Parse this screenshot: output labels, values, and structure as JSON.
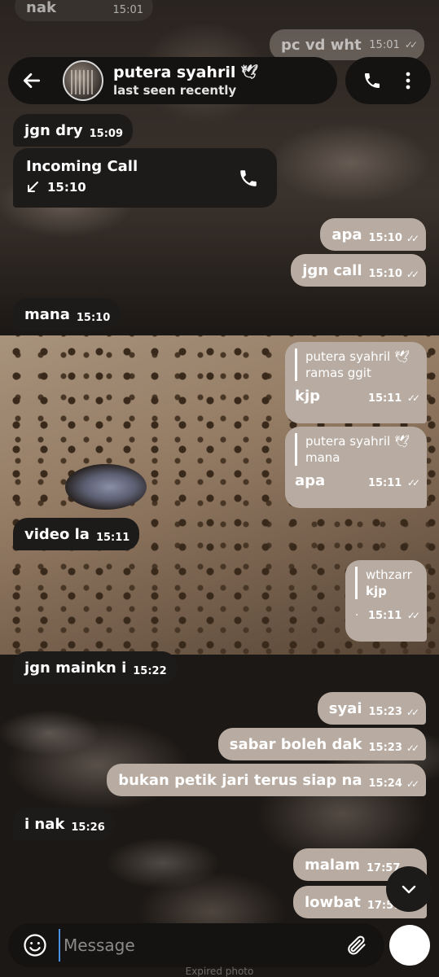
{
  "ghost": {
    "top_left_text": "nak",
    "top_left_time": "15:01",
    "top_right_text": "pc vd wht",
    "top_right_time": "15:01"
  },
  "header": {
    "name": "putera syahril",
    "name_emoji": "🕊",
    "status": "last seen recently"
  },
  "messages": [
    {
      "dir": "in",
      "text": "jgn dry",
      "time": "15:09"
    },
    {
      "dir": "in",
      "kind": "call",
      "title": "Incoming Call",
      "time": "15:10"
    },
    {
      "dir": "out",
      "text": "apa",
      "time": "15:10"
    },
    {
      "dir": "out",
      "text": "jgn call",
      "time": "15:10"
    },
    {
      "dir": "in",
      "text": "mana",
      "time": "15:10"
    },
    {
      "dir": "out",
      "kind": "reply",
      "quote_author": "putera syahril",
      "quote_text": "ramas ggit",
      "text": "kjp",
      "time": "15:11"
    },
    {
      "dir": "out",
      "kind": "reply",
      "quote_author": "putera syahril",
      "quote_text": "mana",
      "text": "apa",
      "time": "15:11"
    },
    {
      "dir": "in",
      "text": "video la",
      "time": "15:11"
    },
    {
      "dir": "out",
      "kind": "quote",
      "quote_author": "wthzarr",
      "quote_text": "kjp",
      "text": "·",
      "time": "15:11"
    },
    {
      "dir": "in",
      "text": "jgn mainkn i",
      "time": "15:22"
    },
    {
      "dir": "out",
      "text": "syai",
      "time": "15:23"
    },
    {
      "dir": "out",
      "text": "sabar boleh dak",
      "time": "15:23"
    },
    {
      "dir": "out",
      "text": "bukan petik jari terus siap na",
      "time": "15:24"
    },
    {
      "dir": "in",
      "text": "i nak",
      "time": "15:26"
    },
    {
      "dir": "out",
      "text": "malam",
      "time": "17:57"
    },
    {
      "dir": "out",
      "text": "lowbat",
      "time": "17:57"
    }
  ],
  "input": {
    "placeholder": "Message"
  },
  "footer": {
    "expired_text": "Expired photo"
  },
  "colors": {
    "incoming_bubble": "#1d1b1a",
    "outgoing_bubble": "#b8aca2",
    "bar": "#151312",
    "caret": "#4a90e2"
  }
}
